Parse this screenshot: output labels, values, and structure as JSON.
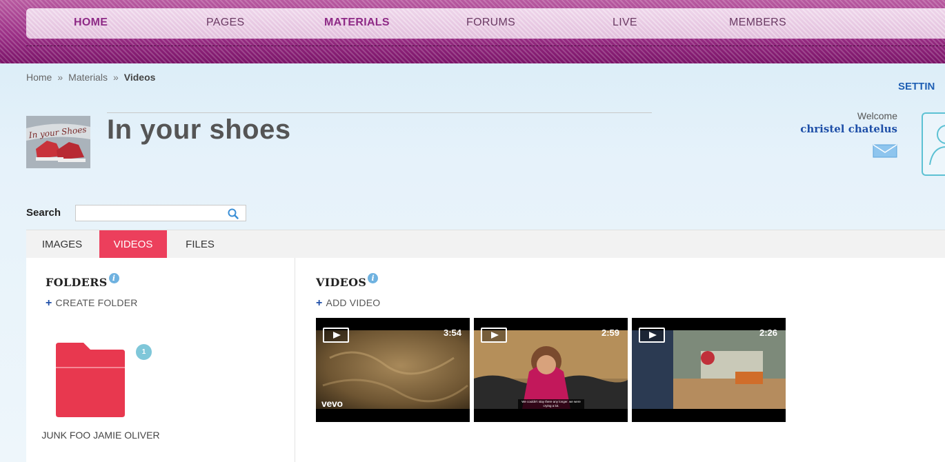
{
  "nav": {
    "items": [
      {
        "label": "HOME",
        "active": true
      },
      {
        "label": "PAGES",
        "active": false
      },
      {
        "label": "MATERIALS",
        "active": true
      },
      {
        "label": "FORUMS",
        "active": false
      },
      {
        "label": "LIVE",
        "active": false
      },
      {
        "label": "MEMBERS",
        "active": false
      }
    ]
  },
  "breadcrumb": {
    "items": [
      "Home",
      "Materials",
      "Videos"
    ],
    "separator": "»"
  },
  "settings_label": "SETTIN",
  "group": {
    "title": "In your shoes",
    "logo_text": "In your Shoes"
  },
  "user": {
    "welcome": "Welcome",
    "name": "christel chatelus"
  },
  "search": {
    "label": "Search",
    "value": "",
    "placeholder": ""
  },
  "tabs": [
    {
      "label": "IMAGES",
      "active": false
    },
    {
      "label": "VIDEOS",
      "active": true
    },
    {
      "label": "FILES",
      "active": false
    }
  ],
  "folders_panel": {
    "title": "FOLDERS",
    "create_label": "CREATE FOLDER",
    "folders": [
      {
        "name": "JUNK FOO JAMIE OLIVER",
        "count": "1"
      }
    ]
  },
  "videos_panel": {
    "title": "VIDEOS",
    "add_label": "ADD VIDEO",
    "videos": [
      {
        "duration": "3:54",
        "overlay": "vevo"
      },
      {
        "duration": "2:59",
        "caption": "We couldn't stay there any longer. we were crying a lot."
      },
      {
        "duration": "2:26"
      }
    ]
  },
  "colors": {
    "nav_bg": "#9b2f86",
    "nav_active": "#8e2a86",
    "tab_active": "#ec3f5c",
    "folder": "#e8384f",
    "link_blue": "#1f4fa8",
    "avatar_border": "#5cc1d3"
  },
  "icons": [
    "search-icon",
    "mail-icon",
    "info-icon",
    "plus-icon",
    "folder-icon",
    "play-icon",
    "avatar-icon"
  ]
}
